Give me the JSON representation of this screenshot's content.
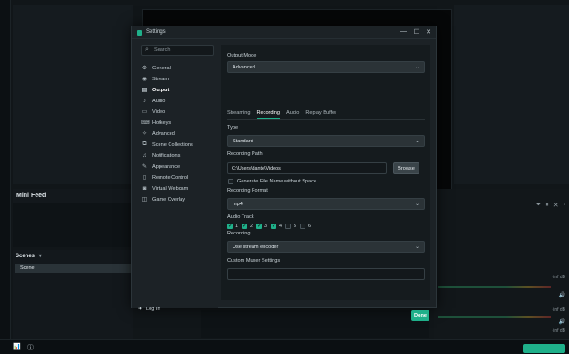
{
  "background": {
    "minifeed_title": "Mini Feed",
    "scenes_title": "Scenes",
    "scenes_dropdown_glyph": "▾",
    "scene_item": "Scene",
    "mixer_level_labels": [
      "-inf dB",
      "-inf dB",
      "-inf dB"
    ]
  },
  "dialog": {
    "title": "Settings",
    "search_placeholder": "Search",
    "nav": [
      {
        "label": "General",
        "icon": "gear-icon"
      },
      {
        "label": "Stream",
        "icon": "globe-icon"
      },
      {
        "label": "Output",
        "icon": "output-icon",
        "active": true
      },
      {
        "label": "Audio",
        "icon": "speaker-icon"
      },
      {
        "label": "Video",
        "icon": "monitor-icon"
      },
      {
        "label": "Hotkeys",
        "icon": "keyboard-icon"
      },
      {
        "label": "Advanced",
        "icon": "wrench-icon"
      },
      {
        "label": "Scene Collections",
        "icon": "collections-icon"
      },
      {
        "label": "Notifications",
        "icon": "bell-icon"
      },
      {
        "label": "Appearance",
        "icon": "paint-icon"
      },
      {
        "label": "Remote Control",
        "icon": "remote-icon"
      },
      {
        "label": "Virtual Webcam",
        "icon": "camera-icon"
      },
      {
        "label": "Game Overlay",
        "icon": "overlay-icon"
      }
    ],
    "login_label": "Log In",
    "output_mode_label": "Output Mode",
    "output_mode_value": "Advanced",
    "tabs": [
      {
        "label": "Streaming",
        "active": false
      },
      {
        "label": "Recording",
        "active": true
      },
      {
        "label": "Audio",
        "active": false
      },
      {
        "label": "Replay Buffer",
        "active": false
      }
    ],
    "type_label": "Type",
    "type_value": "Standard",
    "recording_path_label": "Recording Path",
    "recording_path_value": "C:\\Users\\dante\\Videos",
    "browse_label": "Browse",
    "no_space_label": "Generate File Name without Space",
    "no_space_checked": false,
    "format_label": "Recording Format",
    "format_value": "mp4",
    "audio_track_label": "Audio Track",
    "tracks": [
      {
        "n": "1",
        "checked": true
      },
      {
        "n": "2",
        "checked": true
      },
      {
        "n": "3",
        "checked": true
      },
      {
        "n": "4",
        "checked": true
      },
      {
        "n": "5",
        "checked": false
      },
      {
        "n": "6",
        "checked": false
      }
    ],
    "recording_encoder_label": "Recording",
    "recording_encoder_value": "Use stream encoder",
    "muxer_label": "Custom Muxer Settings",
    "muxer_value": "",
    "done_label": "Done"
  },
  "colors": {
    "accent": "#1fb08a",
    "dialog_bg": "#1c2226",
    "content_bg": "#151b1e"
  }
}
